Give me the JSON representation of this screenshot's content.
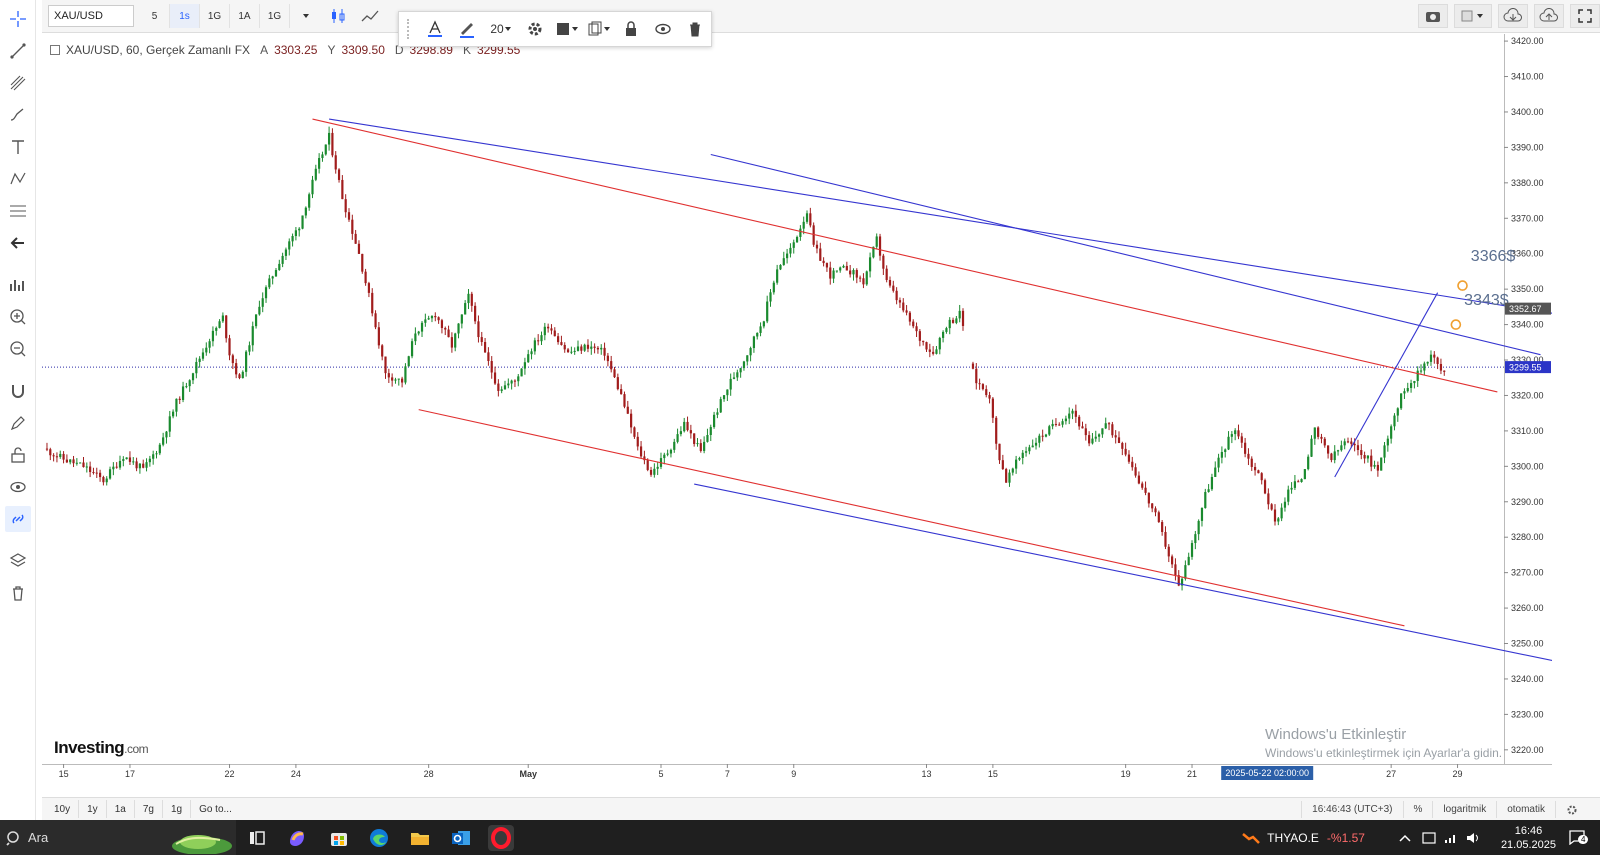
{
  "toolbar": {
    "symbol": "XAU/USD",
    "timeframes": [
      {
        "label": "5",
        "active": false
      },
      {
        "label": "1s",
        "active": true
      },
      {
        "label": "1G",
        "active": false
      },
      {
        "label": "1A",
        "active": false
      },
      {
        "label": "1G",
        "active": false
      }
    ],
    "line_size": "20"
  },
  "legend": {
    "title": "XAU/USD, 60, Gerçek Zamanlı FX",
    "o_label": "A",
    "o": "3303.25",
    "h_label": "Y",
    "h": "3309.50",
    "l_label": "D",
    "l": "3298.89",
    "c_label": "K",
    "c": "3299.55"
  },
  "logo": {
    "main": "Investing",
    "suffix": ".com"
  },
  "watermark": {
    "line1": "Windows'u Etkinleştir",
    "line2": "Windows'u etkinleştirmek için Ayarlar'a gidin."
  },
  "chart_data": {
    "type": "line",
    "y_axis": {
      "ticks": [
        "3420.00",
        "3410.00",
        "3400.00",
        "3390.00",
        "3380.00",
        "3370.00",
        "3360.00",
        "3350.00",
        "3340.00",
        "3330.00",
        "3320.00",
        "3310.00",
        "3300.00",
        "3290.00",
        "3280.00",
        "3270.00",
        "3260.00",
        "3250.00",
        "3240.00",
        "3230.00",
        "3220.00"
      ],
      "tick_values": [
        3420,
        3410,
        3400,
        3390,
        3380,
        3370,
        3360,
        3350,
        3340,
        3330,
        3320,
        3310,
        3300,
        3290,
        3280,
        3270,
        3260,
        3250,
        3240,
        3230,
        3220
      ],
      "range": [
        3216,
        3422
      ]
    },
    "x_axis": {
      "labels": [
        "15",
        "17",
        "22",
        "24",
        "28",
        "May",
        "5",
        "7",
        "9",
        "13",
        "15",
        "19",
        "21",
        "27",
        "29"
      ],
      "label_day": [
        0,
        2,
        5,
        7,
        11,
        14,
        18,
        20,
        22,
        26,
        28,
        32,
        34,
        40,
        42
      ],
      "range": [
        -0.65,
        43.4
      ],
      "crosshair_label": "2025-05-22 02:00:00",
      "crosshair_day": 35
    },
    "price_line": {
      "value": 3328.0,
      "label": "3299.55"
    },
    "price_badges": [
      {
        "value": 3344.5,
        "label": "3352.67"
      }
    ],
    "price_path": [
      [
        -0.6,
        3305
      ],
      [
        0,
        3302
      ],
      [
        0.6,
        3300
      ],
      [
        1.2,
        3296
      ],
      [
        1.8,
        3303
      ],
      [
        2.4,
        3299
      ],
      [
        2.9,
        3306
      ],
      [
        3.4,
        3318
      ],
      [
        3.9,
        3327
      ],
      [
        4.4,
        3336
      ],
      [
        4.8,
        3342
      ],
      [
        5.0,
        3332
      ],
      [
        5.3,
        3324
      ],
      [
        5.9,
        3346
      ],
      [
        6.5,
        3358
      ],
      [
        7.1,
        3368
      ],
      [
        7.7,
        3386
      ],
      [
        8.0,
        3393
      ],
      [
        8.4,
        3376
      ],
      [
        8.9,
        3360
      ],
      [
        9.3,
        3344
      ],
      [
        9.7,
        3326
      ],
      [
        10.2,
        3324
      ],
      [
        10.6,
        3338
      ],
      [
        11.2,
        3343
      ],
      [
        11.7,
        3334
      ],
      [
        12.2,
        3348
      ],
      [
        12.6,
        3334
      ],
      [
        13.1,
        3322
      ],
      [
        13.6,
        3324
      ],
      [
        14.0,
        3332
      ],
      [
        14.6,
        3340
      ],
      [
        15.2,
        3332
      ],
      [
        15.8,
        3334
      ],
      [
        16.3,
        3332
      ],
      [
        16.8,
        3320
      ],
      [
        17.3,
        3305
      ],
      [
        17.7,
        3298
      ],
      [
        18.2,
        3304
      ],
      [
        18.7,
        3312
      ],
      [
        19.2,
        3304
      ],
      [
        19.6,
        3314
      ],
      [
        20.1,
        3324
      ],
      [
        20.5,
        3330
      ],
      [
        21.1,
        3342
      ],
      [
        21.5,
        3356
      ],
      [
        21.9,
        3361
      ],
      [
        22.4,
        3372
      ],
      [
        22.6,
        3362
      ],
      [
        23.1,
        3354
      ],
      [
        23.6,
        3356
      ],
      [
        24.1,
        3352
      ],
      [
        24.5,
        3364
      ],
      [
        24.8,
        3352
      ],
      [
        25.3,
        3344
      ],
      [
        25.8,
        3336
      ],
      [
        26.2,
        3332
      ],
      [
        26.6,
        3340
      ],
      [
        27.0,
        3343
      ],
      [
        27.2,
        3337
      ]
    ],
    "price_path_2": [
      [
        27.3,
        3329
      ],
      [
        27.5,
        3324
      ],
      [
        27.9,
        3320
      ],
      [
        28.1,
        3306
      ],
      [
        28.4,
        3296
      ],
      [
        28.9,
        3304
      ],
      [
        29.4,
        3308
      ],
      [
        29.9,
        3312
      ],
      [
        30.4,
        3316
      ],
      [
        30.9,
        3306
      ],
      [
        31.4,
        3312
      ],
      [
        31.9,
        3306
      ],
      [
        32.4,
        3296
      ],
      [
        32.9,
        3286
      ],
      [
        33.2,
        3278
      ],
      [
        33.6,
        3266
      ],
      [
        34.0,
        3278
      ],
      [
        34.4,
        3292
      ],
      [
        34.9,
        3304
      ],
      [
        35.3,
        3311
      ],
      [
        35.7,
        3302
      ],
      [
        36.1,
        3296
      ],
      [
        36.5,
        3284
      ],
      [
        36.9,
        3293
      ],
      [
        37.3,
        3297
      ],
      [
        37.7,
        3310
      ],
      [
        38.2,
        3302
      ],
      [
        38.6,
        3307
      ],
      [
        39.1,
        3304
      ],
      [
        39.6,
        3299
      ],
      [
        40.0,
        3312
      ],
      [
        40.4,
        3322
      ],
      [
        40.8,
        3326
      ],
      [
        41.2,
        3332
      ],
      [
        41.5,
        3327
      ],
      [
        41.7,
        3325
      ]
    ],
    "trendlines": [
      {
        "color": "#3535d0",
        "from": [
          8.0,
          3398
        ],
        "to": [
          47.0,
          3340
        ]
      },
      {
        "color": "#3535d0",
        "from": [
          19.5,
          3388
        ],
        "to": [
          44.5,
          3331.5
        ]
      },
      {
        "color": "#e03030",
        "from": [
          7.5,
          3398
        ],
        "to": [
          43.2,
          3321
        ]
      },
      {
        "color": "#e03030",
        "from": [
          10.7,
          3316
        ],
        "to": [
          40.4,
          3255
        ]
      },
      {
        "color": "#3535d0",
        "from": [
          19.0,
          3295
        ],
        "to": [
          46.0,
          3243
        ]
      },
      {
        "color": "#3535d0",
        "from": [
          38.3,
          3297
        ],
        "to": [
          41.4,
          3349
        ]
      }
    ],
    "annotations": [
      {
        "label": "3366$",
        "at": [
          42.15,
          3351
        ],
        "text_at": [
          42.4,
          3358
        ]
      },
      {
        "label": "3343$",
        "at": [
          41.95,
          3340
        ],
        "text_at": [
          42.2,
          3345.5
        ]
      }
    ]
  },
  "bottom": {
    "ranges": [
      "10y",
      "1y",
      "1a",
      "7g",
      "1g",
      "Go to..."
    ],
    "time": "16:46:43 (UTC+3)",
    "percent": "%",
    "log": "logaritmik",
    "auto": "otomatik"
  },
  "taskbar": {
    "search": "Ara",
    "ticker_name": "THYAO.E",
    "ticker_change": "-%1.57",
    "time": "16:46",
    "date": "21.05.2025",
    "notif_count": "4"
  },
  "colors": {
    "up": "#1a8a2e",
    "down": "#a11c1c",
    "accent": "#2962ff"
  }
}
